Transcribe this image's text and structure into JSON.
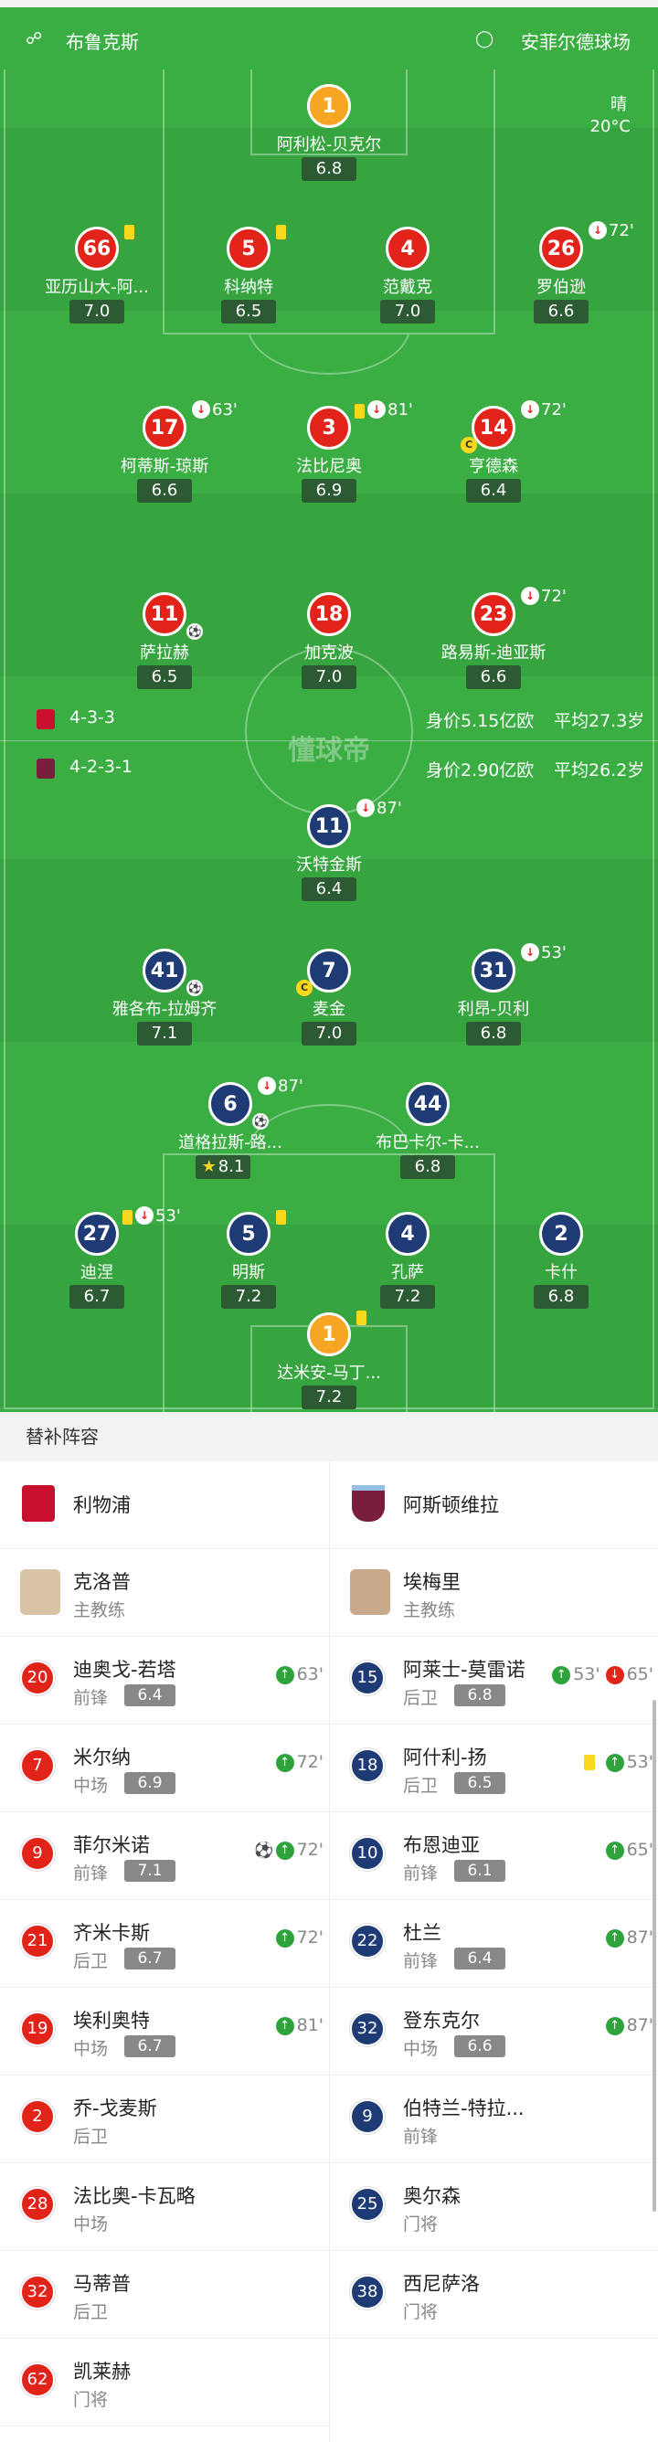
{
  "match": {
    "home_team": "布鲁克斯",
    "away_team": "安菲尔德球场",
    "weather": "晴",
    "temperature": "20°C",
    "watermark": "懂球帝"
  },
  "colors": {
    "pitch": "#3aad43",
    "home": "#e2231a",
    "away": "#1f3b76",
    "gk": "#f6a623"
  },
  "liverpool_formation": {
    "formation": "4-3-3",
    "value": "身价5.15亿欧",
    "age": "平均27.3岁"
  },
  "villa_formation": {
    "formation": "4-2-3-1",
    "value": "身价2.90亿欧",
    "age": "平均26.2岁"
  },
  "players": [
    {
      "num": "1",
      "name": "阿利松-贝克尔",
      "rating": "6.8",
      "team": "gk"
    },
    {
      "num": "66",
      "name": "亚历山大-阿...",
      "rating": "7.0",
      "team": "red",
      "yellow": true
    },
    {
      "num": "5",
      "name": "科纳特",
      "rating": "6.5",
      "team": "red",
      "yellow": true
    },
    {
      "num": "4",
      "name": "范戴克",
      "rating": "7.0",
      "team": "red"
    },
    {
      "num": "26",
      "name": "罗伯逊",
      "rating": "6.6",
      "team": "red",
      "subout": "72'"
    },
    {
      "num": "17",
      "name": "柯蒂斯-琼斯",
      "rating": "6.6",
      "team": "red",
      "subout": "63'"
    },
    {
      "num": "3",
      "name": "法比尼奥",
      "rating": "6.9",
      "team": "red",
      "yellow": true,
      "subout": "81'"
    },
    {
      "num": "14",
      "name": "亨德森",
      "rating": "6.4",
      "team": "red",
      "captain": "C",
      "subout": "72'"
    },
    {
      "num": "11",
      "name": "萨拉赫",
      "rating": "6.5",
      "team": "red",
      "ball": true
    },
    {
      "num": "18",
      "name": "加克波",
      "rating": "7.0",
      "team": "red"
    },
    {
      "num": "23",
      "name": "路易斯-迪亚斯",
      "rating": "6.6",
      "team": "red",
      "subout": "72'"
    },
    {
      "num": "11",
      "name": "沃特金斯",
      "rating": "6.4",
      "team": "blue",
      "subout": "87'"
    },
    {
      "num": "41",
      "name": "雅各布-拉姆齐",
      "rating": "7.1",
      "team": "blue",
      "ball": true
    },
    {
      "num": "7",
      "name": "麦金",
      "rating": "7.0",
      "team": "blue",
      "captain": "C"
    },
    {
      "num": "31",
      "name": "利昂-贝利",
      "rating": "6.8",
      "team": "blue",
      "subout": "53'"
    },
    {
      "num": "6",
      "name": "道格拉斯-路...",
      "rating": "8.1",
      "team": "blue",
      "ball": true,
      "subout": "87'",
      "star": true
    },
    {
      "num": "44",
      "name": "布巴卡尔-卡...",
      "rating": "6.8",
      "team": "blue"
    },
    {
      "num": "27",
      "name": "迪涅",
      "rating": "6.7",
      "team": "blue",
      "yellow": true,
      "subout": "53'"
    },
    {
      "num": "5",
      "name": "明斯",
      "rating": "7.2",
      "team": "blue",
      "yellow": true
    },
    {
      "num": "4",
      "name": "孔萨",
      "rating": "7.2",
      "team": "blue"
    },
    {
      "num": "2",
      "name": "卡什",
      "rating": "6.8",
      "team": "blue"
    },
    {
      "num": "1",
      "name": "达米安-马丁...",
      "rating": "7.2",
      "team": "gk",
      "yellow": true
    }
  ],
  "subs": {
    "title": "替补阵容",
    "home": {
      "team": "利物浦",
      "coach": {
        "name": "克洛普",
        "role": "主教练"
      },
      "players": [
        {
          "num": "20",
          "name": "迪奥戈-若塔",
          "pos": "前锋",
          "rating": "6.4",
          "in": "63'"
        },
        {
          "num": "7",
          "name": "米尔纳",
          "pos": "中场",
          "rating": "6.9",
          "in": "72'"
        },
        {
          "num": "9",
          "name": "菲尔米诺",
          "pos": "前锋",
          "rating": "7.1",
          "in": "72'",
          "ball": true
        },
        {
          "num": "21",
          "name": "齐米卡斯",
          "pos": "后卫",
          "rating": "6.7",
          "in": "72'"
        },
        {
          "num": "19",
          "name": "埃利奥特",
          "pos": "中场",
          "rating": "6.7",
          "in": "81'"
        },
        {
          "num": "2",
          "name": "乔-戈麦斯",
          "pos": "后卫"
        },
        {
          "num": "28",
          "name": "法比奥-卡瓦略",
          "pos": "中场"
        },
        {
          "num": "32",
          "name": "马蒂普",
          "pos": "后卫"
        },
        {
          "num": "62",
          "name": "凯莱赫",
          "pos": "门将"
        }
      ]
    },
    "away": {
      "team": "阿斯顿维拉",
      "coach": {
        "name": "埃梅里",
        "role": "主教练"
      },
      "players": [
        {
          "num": "15",
          "name": "阿莱士-莫雷诺",
          "pos": "后卫",
          "rating": "6.8",
          "in": "53'",
          "out": "65'"
        },
        {
          "num": "18",
          "name": "阿什利-扬",
          "pos": "后卫",
          "rating": "6.5",
          "in": "53'",
          "yellow": true
        },
        {
          "num": "10",
          "name": "布恩迪亚",
          "pos": "前锋",
          "rating": "6.1",
          "in": "65'"
        },
        {
          "num": "22",
          "name": "杜兰",
          "pos": "前锋",
          "rating": "6.4",
          "in": "87'"
        },
        {
          "num": "32",
          "name": "登东克尔",
          "pos": "中场",
          "rating": "6.6",
          "in": "87'"
        },
        {
          "num": "9",
          "name": "伯特兰-特拉...",
          "pos": "前锋"
        },
        {
          "num": "25",
          "name": "奥尔森",
          "pos": "门将"
        },
        {
          "num": "38",
          "name": "西尼萨洛",
          "pos": "门将"
        }
      ]
    }
  }
}
